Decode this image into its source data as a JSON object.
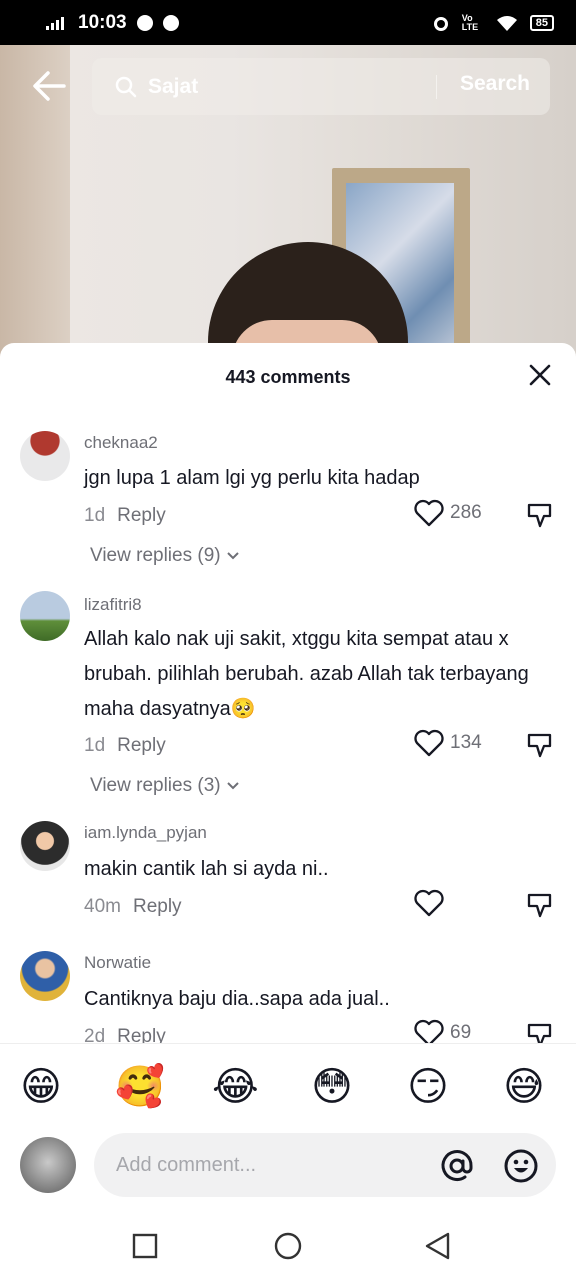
{
  "status_bar": {
    "time": "10:03",
    "battery": "85",
    "network": "Vo LTE"
  },
  "search": {
    "query": "Sajat",
    "button_label": "Search"
  },
  "comments_panel": {
    "title": "443 comments",
    "comments": [
      {
        "username": "cheknaa2",
        "text": "jgn lupa 1 alam lgi yg perlu kita hadap",
        "age": "1d",
        "reply_label": "Reply",
        "likes": "286",
        "view_replies": "View replies (9)"
      },
      {
        "username": "lizafitri8",
        "text": "Allah kalo nak uji sakit, xtggu kita sempat atau x brubah. pilihlah berubah. azab Allah tak terbayang maha dasyatnya🥺",
        "age": "1d",
        "reply_label": "Reply",
        "likes": "134",
        "view_replies": "View replies (3)"
      },
      {
        "username": "iam.lynda_pyjan",
        "text": "makin cantik lah si ayda ni..",
        "age": "40m",
        "reply_label": "Reply",
        "likes": ""
      },
      {
        "username": "Norwatie",
        "text": "Cantiknya baju dia..sapa ada jual..",
        "age": "2d",
        "reply_label": "Reply",
        "likes": "69"
      }
    ]
  },
  "emoji_bar": [
    "😁",
    "🥰",
    "😂",
    "😳",
    "😏",
    "😅"
  ],
  "composer": {
    "placeholder": "Add comment..."
  }
}
